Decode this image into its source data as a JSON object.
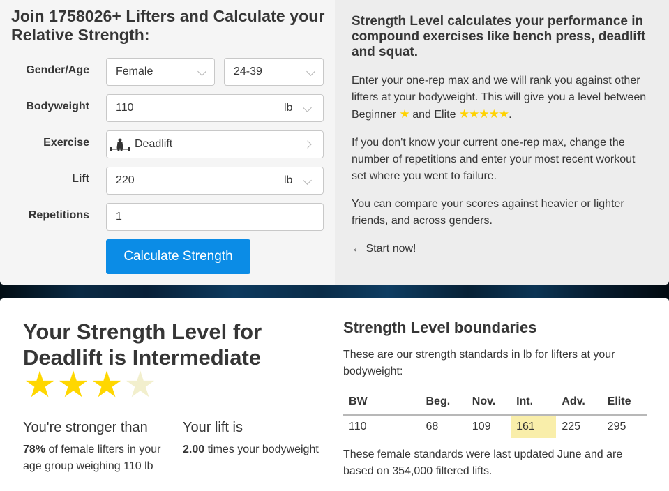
{
  "form": {
    "title": "Join 1758026+ Lifters and Calculate your Relative Strength:",
    "gender_age_label": "Gender/Age",
    "gender_value": "Female",
    "age_value": "24-39",
    "bodyweight_label": "Bodyweight",
    "bodyweight_value": "110",
    "bodyweight_unit": "lb",
    "exercise_label": "Exercise",
    "exercise_value": "Deadlift",
    "exercise_icon": "deadlift-icon",
    "lift_label": "Lift",
    "lift_value": "220",
    "lift_unit": "lb",
    "repetitions_label": "Repetitions",
    "repetitions_value": "1",
    "calculate_button": "Calculate Strength",
    "button_color": "#0b8ce6"
  },
  "info": {
    "title": "Strength Level calculates your performance in compound exercises like bench press, deadlift and squat.",
    "p1_text": "Enter your one-rep max and we will rank you against other lifters at your bodyweight. This will give you a level between Beginner",
    "p1_star_one": "★",
    "p1_mid": "and Elite",
    "p1_star_five": "★★★★★",
    "p1_end": ".",
    "p2": "If you don't know your current one-rep max, change the number of repetitions and enter your most recent workout set where you went to failure.",
    "p3": "You can compare your scores against heavier or lighter friends, and across genders.",
    "start_arrow": "←",
    "start_label": "Start now!"
  },
  "result": {
    "title": "Your Strength Level for Deadlift is Intermediate",
    "stars_filled": 3,
    "stars_total": 4,
    "star_glyph": "★",
    "star_color": "#ffd700",
    "stronger_heading": "You're stronger than",
    "stronger_percent": "78%",
    "stronger_text": "of female lifters in your age group weighing 110 lb",
    "lift_heading": "Your lift is",
    "lift_ratio": "2.00",
    "lift_text": "times your bodyweight"
  },
  "boundaries": {
    "title": "Strength Level boundaries",
    "description": "These are our strength standards in lb for lifters at your bodyweight:",
    "headers": [
      "BW",
      "Beg.",
      "Nov.",
      "Int.",
      "Adv.",
      "Elite"
    ],
    "row": [
      "110",
      "68",
      "109",
      "161",
      "225",
      "295"
    ],
    "highlight_index": 3,
    "highlight_color": "#f9eeaa",
    "footer": "These female standards were last updated June and are based on 354,000 filtered lifts."
  }
}
